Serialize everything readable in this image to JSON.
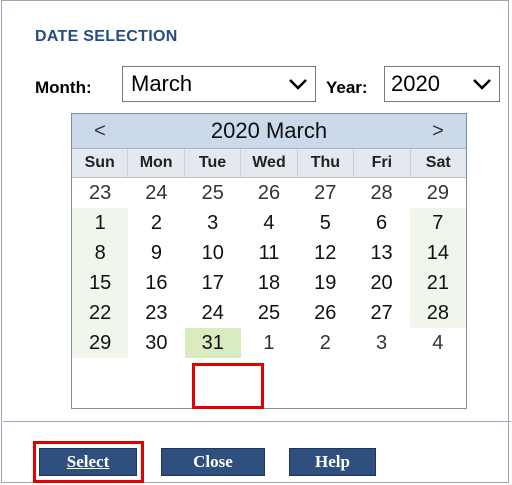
{
  "dialog": {
    "title": "DATE SELECTION",
    "month_label": "Month:",
    "month_value": "March",
    "year_label": "Year:",
    "year_value": "2020"
  },
  "calendar": {
    "prev": "<",
    "next": ">",
    "title": "2020 March",
    "weekdays": [
      "Sun",
      "Mon",
      "Tue",
      "Wed",
      "Thu",
      "Fri",
      "Sat"
    ],
    "weeks": [
      [
        "23",
        "24",
        "25",
        "26",
        "27",
        "28",
        "29"
      ],
      [
        "1",
        "2",
        "3",
        "4",
        "5",
        "6",
        "7"
      ],
      [
        "8",
        "9",
        "10",
        "11",
        "12",
        "13",
        "14"
      ],
      [
        "15",
        "16",
        "17",
        "18",
        "19",
        "20",
        "21"
      ],
      [
        "22",
        "23",
        "24",
        "25",
        "26",
        "27",
        "28"
      ],
      [
        "29",
        "30",
        "31",
        "1",
        "2",
        "3",
        "4"
      ]
    ],
    "selected_day": "31",
    "weekend_color": "#f1f6ea",
    "selected_color": "#d8ecc0",
    "header_color": "#ccd9ea"
  },
  "buttons": {
    "select": "Select",
    "close": "Close",
    "help": "Help",
    "button_color": "#2f4f7e"
  },
  "highlight_color": "#e00000"
}
